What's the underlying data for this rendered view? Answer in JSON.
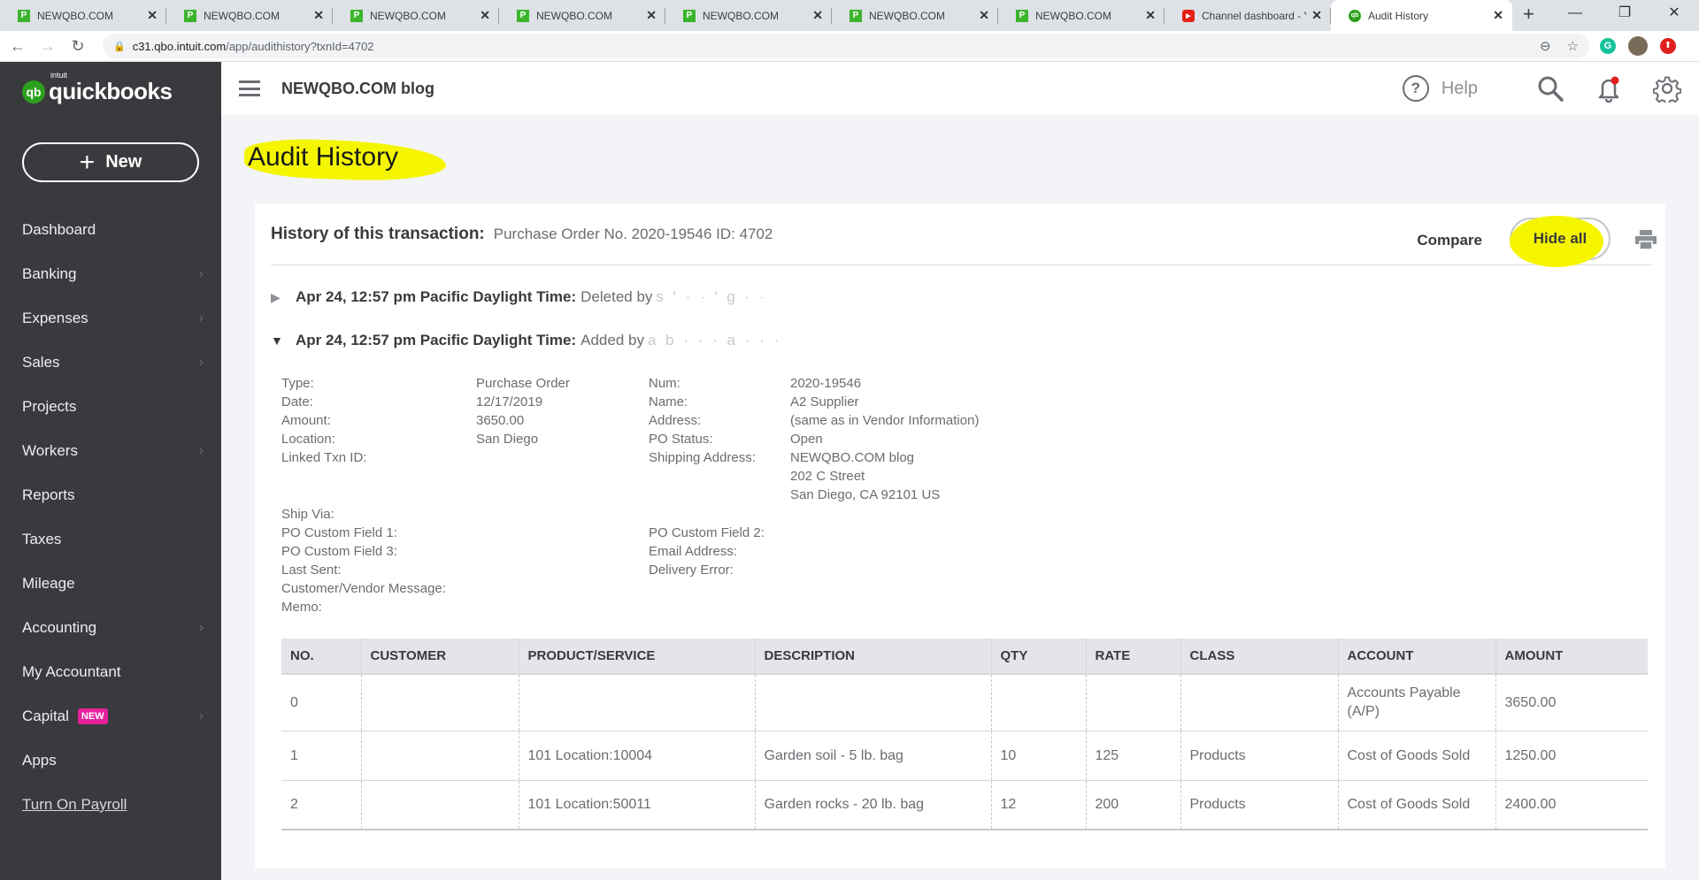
{
  "browser": {
    "tabs": [
      {
        "title": "NEWQBO.COM",
        "icon": "newqbo-favicon",
        "active": false
      },
      {
        "title": "NEWQBO.COM",
        "icon": "newqbo-favicon",
        "active": false
      },
      {
        "title": "NEWQBO.COM",
        "icon": "newqbo-favicon",
        "active": false
      },
      {
        "title": "NEWQBO.COM",
        "icon": "newqbo-favicon",
        "active": false
      },
      {
        "title": "NEWQBO.COM",
        "icon": "newqbo-favicon",
        "active": false
      },
      {
        "title": "NEWQBO.COM",
        "icon": "newqbo-favicon",
        "active": false
      },
      {
        "title": "NEWQBO.COM",
        "icon": "newqbo-favicon",
        "active": false
      },
      {
        "title": "Channel dashboard - Yo",
        "icon": "youtube-favicon",
        "active": false
      },
      {
        "title": "Audit History",
        "icon": "quickbooks-favicon",
        "active": true
      }
    ],
    "url_host": "c31.qbo.intuit.com",
    "url_path": "/app/audithistory?txnId=4702",
    "favicon_letter": "P",
    "new_tab_symbol": "+",
    "window_controls": {
      "minimize": "—",
      "restore": "❐",
      "close": "✕"
    },
    "extension_grammarly": "G"
  },
  "app": {
    "logo_intuit": "intuit",
    "logo_brand": "quickbooks",
    "logo_mark": "qb",
    "new_button": "New",
    "new_button_icon": "+",
    "company_name": "NEWQBO.COM blog",
    "help_label": "Help",
    "help_icon": "?",
    "brand_color": "#2ca01c",
    "sidebar_bg": "#393a3d"
  },
  "sidebar": {
    "items": [
      {
        "label": "Dashboard",
        "chevron": false
      },
      {
        "label": "Banking",
        "chevron": true
      },
      {
        "label": "Expenses",
        "chevron": true
      },
      {
        "label": "Sales",
        "chevron": true
      },
      {
        "label": "Projects",
        "chevron": false
      },
      {
        "label": "Workers",
        "chevron": true
      },
      {
        "label": "Reports",
        "chevron": false
      },
      {
        "label": "Taxes",
        "chevron": false
      },
      {
        "label": "Mileage",
        "chevron": false
      },
      {
        "label": "Accounting",
        "chevron": true
      },
      {
        "label": "My Accountant",
        "chevron": false
      },
      {
        "label": "Capital",
        "chevron": true,
        "badge": "NEW"
      },
      {
        "label": "Apps",
        "chevron": false
      },
      {
        "label": "Turn On Payroll",
        "chevron": false,
        "link": true
      }
    ],
    "chevron_symbol": "›"
  },
  "page": {
    "title": "Audit History",
    "history_label": "History of this transaction:",
    "history_value": "Purchase Order No. 2020-19546 ID: 4702",
    "compare_label": "Compare",
    "hide_all_label": "Hide all",
    "highlight_color": "#f5f500"
  },
  "events": [
    {
      "expanded": false,
      "toggle": "▶",
      "when": "Apr 24, 12:57 pm Pacific Daylight Time:",
      "what": "Deleted by",
      "who": "s ' · · ' g · ·"
    },
    {
      "expanded": true,
      "toggle": "▼",
      "when": "Apr 24, 12:57 pm Pacific Daylight Time:",
      "what": "Added by",
      "who": "a b · · · a · · ·"
    }
  ],
  "details": {
    "left": [
      {
        "label": "Type:",
        "value": "Purchase Order"
      },
      {
        "label": "Date:",
        "value": "12/17/2019"
      },
      {
        "label": "Amount:",
        "value": "3650.00"
      },
      {
        "label": "Location:",
        "value": "San Diego"
      },
      {
        "label": "Linked Txn ID:",
        "value": ""
      }
    ],
    "right": [
      {
        "label": "Num:",
        "value": "2020-19546"
      },
      {
        "label": "Name:",
        "value": "A2 Supplier"
      },
      {
        "label": "Address:",
        "value": "(same as in Vendor Information)"
      },
      {
        "label": "PO Status:",
        "value": "Open"
      },
      {
        "label": "Shipping Address:",
        "value": "NEWQBO.COM blog"
      }
    ],
    "shipping_lines": [
      "202 C Street",
      "San Diego, CA  92101 US"
    ],
    "extra_left": [
      "Ship Via:",
      "PO Custom Field 1:",
      "PO Custom Field 3:",
      "Last Sent:",
      "Customer/Vendor Message:",
      "Memo:"
    ],
    "extra_right": [
      "PO Custom Field 2:",
      "Email Address:",
      "Delivery Error:"
    ]
  },
  "table": {
    "headers": [
      "NO.",
      "CUSTOMER",
      "PRODUCT/SERVICE",
      "DESCRIPTION",
      "QTY",
      "RATE",
      "CLASS",
      "ACCOUNT",
      "AMOUNT"
    ],
    "rows": [
      [
        "0",
        "",
        "",
        "",
        "",
        "",
        "",
        "Accounts Payable (A/P)",
        "3650.00"
      ],
      [
        "1",
        "",
        "101 Location:10004",
        "Garden soil - 5 lb. bag",
        "10",
        "125",
        "Products",
        "Cost of Goods Sold",
        "1250.00"
      ],
      [
        "2",
        "",
        "101 Location:50011",
        "Garden rocks - 20 lb. bag",
        "12",
        "200",
        "Products",
        "Cost of Goods Sold",
        "2400.00"
      ]
    ]
  }
}
